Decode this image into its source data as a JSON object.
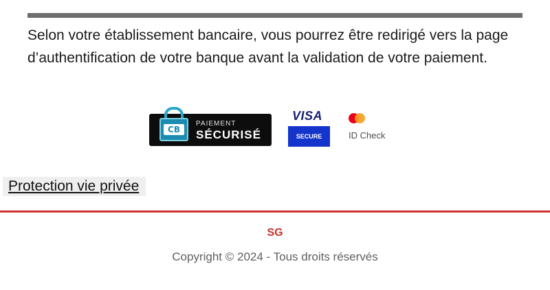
{
  "info": {
    "text": "Selon votre établissement bancaire, vous pourrez être redirigé vers la page d’authentification de votre banque avant la validation de votre paiement."
  },
  "badges": {
    "cb": {
      "logo_text": "CB",
      "label_small": "PAIEMENT",
      "label_big": "SÉCURISÉ",
      "icon": "padlock-icon"
    },
    "visa": {
      "word": "VISA",
      "secure": "SECURE",
      "color": "#1434cb"
    },
    "mastercard": {
      "label": "ID Check",
      "icon": "mastercard-circles-icon"
    }
  },
  "privacy": {
    "link_label": "Protection vie privée"
  },
  "footer": {
    "brand": "SG",
    "copyright": "Copyright © 2024 - Tous droits réservés",
    "accent_color": "#c9302c"
  }
}
